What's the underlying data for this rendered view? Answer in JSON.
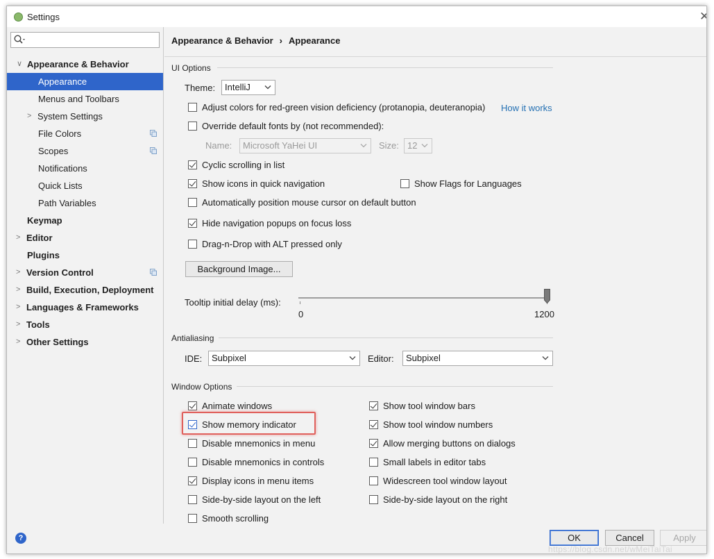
{
  "window": {
    "title": "Settings"
  },
  "sidebar": {
    "search_placeholder": "",
    "items": [
      {
        "label": "Appearance & Behavior",
        "level": 0,
        "expanded": true
      },
      {
        "label": "Appearance",
        "level": 1,
        "selected": true
      },
      {
        "label": "Menus and Toolbars",
        "level": 1
      },
      {
        "label": "System Settings",
        "level": 1,
        "collapsed": true
      },
      {
        "label": "File Colors",
        "level": 1
      },
      {
        "label": "Scopes",
        "level": 1
      },
      {
        "label": "Notifications",
        "level": 1
      },
      {
        "label": "Quick Lists",
        "level": 1
      },
      {
        "label": "Path Variables",
        "level": 1
      },
      {
        "label": "Keymap",
        "level": 0
      },
      {
        "label": "Editor",
        "level": 0
      },
      {
        "label": "Plugins",
        "level": 0
      },
      {
        "label": "Version Control",
        "level": 0
      },
      {
        "label": "Build, Execution, Deployment",
        "level": 0
      },
      {
        "label": "Languages & Frameworks",
        "level": 0
      },
      {
        "label": "Tools",
        "level": 0
      },
      {
        "label": "Other Settings",
        "level": 0
      }
    ]
  },
  "breadcrumb": {
    "parent": "Appearance & Behavior",
    "separator": "›",
    "current": "Appearance"
  },
  "ui_options": {
    "title": "UI Options",
    "theme_label": "Theme:",
    "theme_value": "IntelliJ",
    "adjust_colors": {
      "label": "Adjust colors for red-green vision deficiency (protanopia, deuteranopia)",
      "checked": false
    },
    "how_it_works": "How it works",
    "override_fonts": {
      "label": "Override default fonts by (not recommended):",
      "checked": false
    },
    "font_name_label": "Name:",
    "font_name_value": "Microsoft YaHei UI",
    "font_size_label": "Size:",
    "font_size_value": "12",
    "cyclic_scrolling": {
      "label": "Cyclic scrolling in list",
      "checked": true
    },
    "show_icons_quick_nav": {
      "label": "Show icons in quick navigation",
      "checked": true
    },
    "show_flags": {
      "label": "Show Flags for Languages",
      "checked": false
    },
    "auto_mouse": {
      "label": "Automatically position mouse cursor on default button",
      "checked": false
    },
    "hide_nav_popups": {
      "label": "Hide navigation popups on focus loss",
      "checked": true
    },
    "drag_n_drop": {
      "label": "Drag-n-Drop with ALT pressed only",
      "checked": false
    },
    "background_image_button": "Background Image...",
    "tooltip_label": "Tooltip initial delay (ms):",
    "tooltip_min": "0",
    "tooltip_max": "1200",
    "tooltip_value_fraction": 1.0
  },
  "antialiasing": {
    "title": "Antialiasing",
    "ide_label": "IDE:",
    "ide_value": "Subpixel",
    "editor_label": "Editor:",
    "editor_value": "Subpixel"
  },
  "window_options": {
    "title": "Window Options",
    "left": [
      {
        "label": "Animate windows",
        "checked": true
      },
      {
        "label": "Show memory indicator",
        "checked": true
      },
      {
        "label": "Disable mnemonics in menu",
        "checked": false
      },
      {
        "label": "Disable mnemonics in controls",
        "checked": false
      },
      {
        "label": "Display icons in menu items",
        "checked": true
      },
      {
        "label": "Side-by-side layout on the left",
        "checked": false
      },
      {
        "label": "Smooth scrolling",
        "checked": false
      }
    ],
    "right": [
      {
        "label": "Show tool window bars",
        "checked": true
      },
      {
        "label": "Show tool window numbers",
        "checked": true
      },
      {
        "label": "Allow merging buttons on dialogs",
        "checked": true
      },
      {
        "label": "Small labels in editor tabs",
        "checked": false
      },
      {
        "label": "Widescreen tool window layout",
        "checked": false
      },
      {
        "label": "Side-by-side layout on the right",
        "checked": false
      }
    ]
  },
  "footer": {
    "help": "?",
    "ok": "OK",
    "cancel": "Cancel",
    "apply": "Apply",
    "watermark": "https://blog.csdn.net/wMeiTaiTai"
  },
  "colors": {
    "selection": "#2f65ca",
    "highlight_box": "#e0605c",
    "link": "#2470b3"
  }
}
